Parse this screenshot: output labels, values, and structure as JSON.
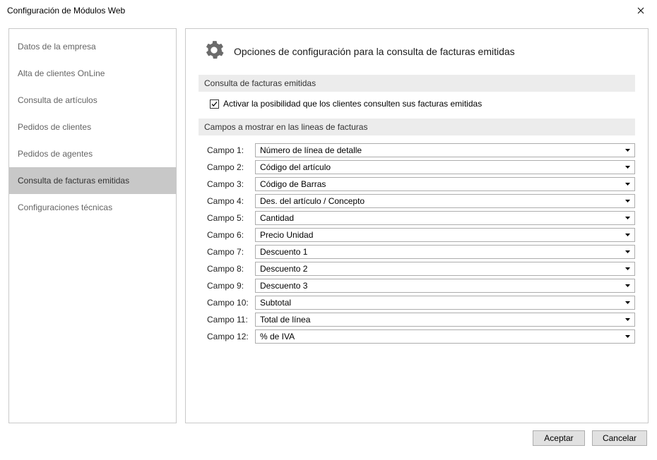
{
  "window": {
    "title": "Configuración de Módulos Web"
  },
  "sidebar": {
    "items": [
      {
        "label": "Datos de la empresa",
        "selected": false
      },
      {
        "label": "Alta de clientes OnLine",
        "selected": false
      },
      {
        "label": "Consulta de artículos",
        "selected": false
      },
      {
        "label": "Pedidos de clientes",
        "selected": false
      },
      {
        "label": "Pedidos de agentes",
        "selected": false
      },
      {
        "label": "Consulta de facturas emitidas",
        "selected": true
      },
      {
        "label": "Configuraciones técnicas",
        "selected": false
      }
    ]
  },
  "main": {
    "heading": "Opciones de configuración para la consulta de facturas emitidas",
    "section1_title": "Consulta de facturas emitidas",
    "checkbox_label": "Activar la posibilidad que los clientes consulten sus facturas emitidas",
    "checkbox_checked": true,
    "section2_title": "Campos a mostrar en las lineas de facturas",
    "fields": [
      {
        "label": "Campo 1:",
        "value": "Número de línea de detalle"
      },
      {
        "label": "Campo 2:",
        "value": "Código del artículo"
      },
      {
        "label": "Campo 3:",
        "value": "Código de Barras"
      },
      {
        "label": "Campo 4:",
        "value": "Des. del artículo / Concepto"
      },
      {
        "label": "Campo 5:",
        "value": "Cantidad"
      },
      {
        "label": "Campo 6:",
        "value": "Precio Unidad"
      },
      {
        "label": "Campo 7:",
        "value": "Descuento 1"
      },
      {
        "label": "Campo 8:",
        "value": "Descuento 2"
      },
      {
        "label": "Campo 9:",
        "value": "Descuento 3"
      },
      {
        "label": "Campo 10:",
        "value": "Subtotal"
      },
      {
        "label": "Campo 11:",
        "value": "Total de línea"
      },
      {
        "label": "Campo 12:",
        "value": "% de IVA"
      }
    ]
  },
  "footer": {
    "accept": "Aceptar",
    "cancel": "Cancelar"
  }
}
